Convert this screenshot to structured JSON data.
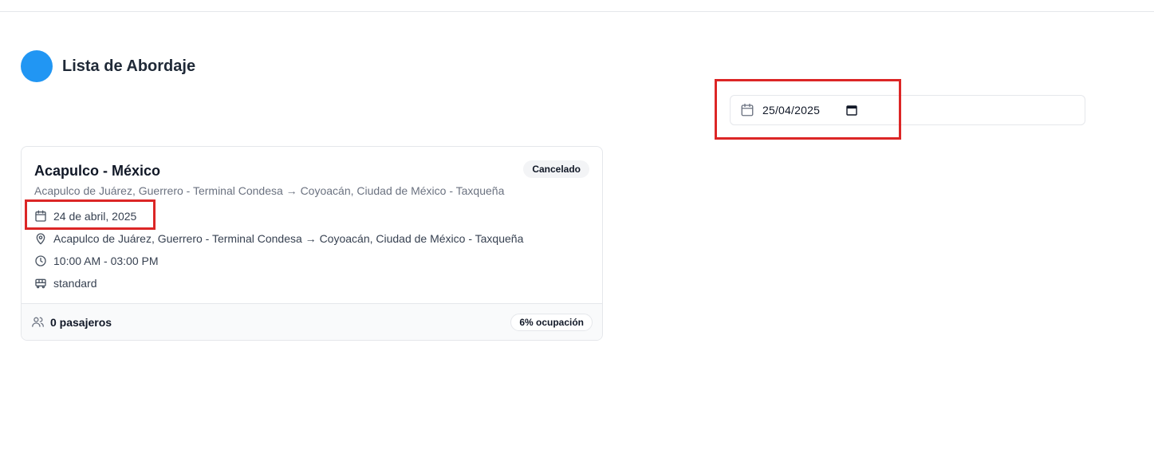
{
  "page": {
    "title": "Lista de Abordaje",
    "brand_color": "#2196f3"
  },
  "filter": {
    "date_value": "25/04/2025",
    "icon": "calendar-icon"
  },
  "trip": {
    "title": "Acapulco - México",
    "status": "Cancelado",
    "route_subtitle": "Acapulco de Juárez, Guerrero - Terminal Condesa → Coyoacán, Ciudad de México - Taxqueña",
    "date": "24 de abril, 2025",
    "route": "Acapulco de Juárez, Guerrero - Terminal Condesa → Coyoacán, Ciudad de México - Taxqueña",
    "time": "10:00 AM - 03:00 PM",
    "bus_type": "standard",
    "passengers": "0 pasajeros",
    "occupancy": "6% ocupación"
  },
  "annotations": {
    "highlight_color": "#dc2626"
  }
}
